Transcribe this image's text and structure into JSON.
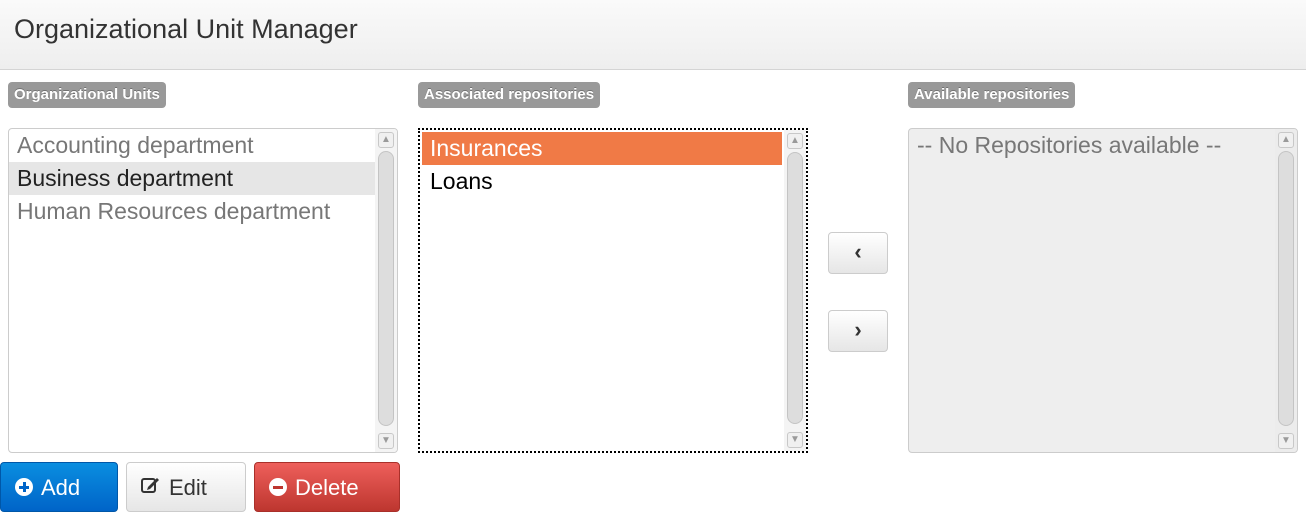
{
  "header": {
    "title": "Organizational Unit Manager"
  },
  "org_units": {
    "label": "Organizational Units",
    "items": [
      {
        "text": "Accounting department",
        "state": "muted"
      },
      {
        "text": "Business department",
        "state": "selected"
      },
      {
        "text": "Human Resources department",
        "state": "muted"
      }
    ]
  },
  "associated": {
    "label": "Associated repositories",
    "items": [
      {
        "text": "Insurances",
        "state": "selected"
      },
      {
        "text": "Loans",
        "state": "normal"
      }
    ]
  },
  "available": {
    "label": "Available repositories",
    "items": [
      {
        "text": "-- No Repositories available --",
        "state": "disabled"
      }
    ]
  },
  "move_buttons": {
    "left_glyph": "‹",
    "right_glyph": "›"
  },
  "actions": {
    "add_label": "Add",
    "edit_label": "Edit",
    "delete_label": "Delete"
  },
  "colors": {
    "add": "#0064c8",
    "delete": "#bd362f",
    "selection": "#f07a46",
    "label_bg": "#999999"
  },
  "icons": {
    "add": "plus-circle-icon",
    "edit": "edit-icon",
    "delete": "minus-circle-icon",
    "move_left": "chevron-left-icon",
    "move_right": "chevron-right-icon"
  }
}
